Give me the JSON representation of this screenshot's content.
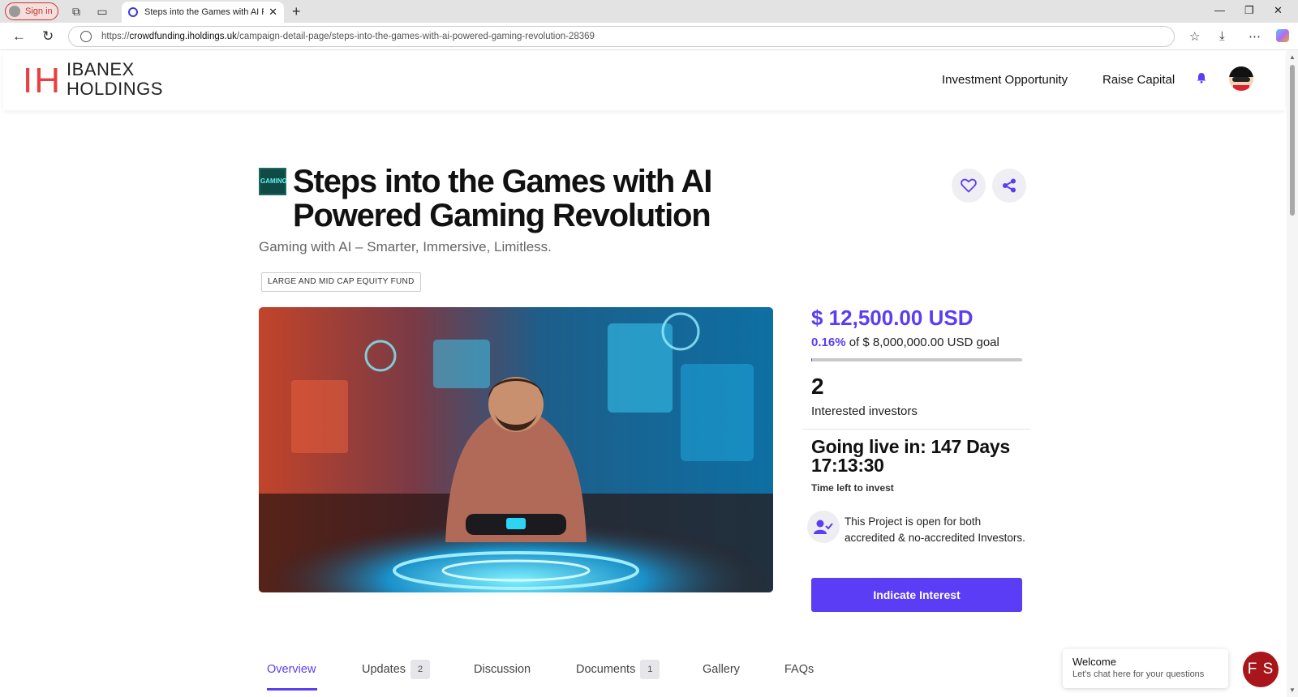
{
  "browser": {
    "signin_label": "Sign in",
    "tab_title": "Steps into the Games with AI Powered Gaming Revolution",
    "url_scheme": "https://",
    "url_host": "crowdfunding.iholdings.uk",
    "url_path": "/campaign-detail-page/steps-into-the-games-with-ai-powered-gaming-revolution-28369"
  },
  "header": {
    "logo_mark": "IH",
    "logo_line1": "IBANEX",
    "logo_line2": "HOLDINGS",
    "nav": [
      "Investment Opportunity",
      "Raise Capital"
    ]
  },
  "campaign": {
    "icon_text": "GAMING",
    "title": "Steps into the Games with AI Powered Gaming Revolution",
    "subtitle": "Gaming with AI – Smarter, Immersive, Limitless.",
    "tag": "LARGE AND MID CAP EQUITY FUND"
  },
  "stats": {
    "raised": "$ 12,500.00 USD",
    "percent": "0.16%",
    "goal_text": "of $ 8,000,000.00 USD goal",
    "progress_fraction": 0.0016,
    "investors_count": "2",
    "investors_label": "Interested investors",
    "going_live": "Going live in: 147 Days 17:13:30",
    "time_left_label": "Time left to invest",
    "accreditation_text": "This Project is open for both accredited & no-accredited Investors.",
    "cta_label": "Indicate Interest"
  },
  "tabs": [
    {
      "label": "Overview",
      "count": ""
    },
    {
      "label": "Updates",
      "count": "2"
    },
    {
      "label": "Discussion",
      "count": ""
    },
    {
      "label": "Documents",
      "count": "1"
    },
    {
      "label": "Gallery",
      "count": ""
    },
    {
      "label": "FAQs",
      "count": ""
    }
  ],
  "chat": {
    "title": "Welcome",
    "subtitle": "Let's chat here for your questions",
    "avatar_initials": "F S"
  },
  "colors": {
    "accent": "#5b3df5",
    "brand_red": "#e84040",
    "chat_red": "#a8161b"
  }
}
